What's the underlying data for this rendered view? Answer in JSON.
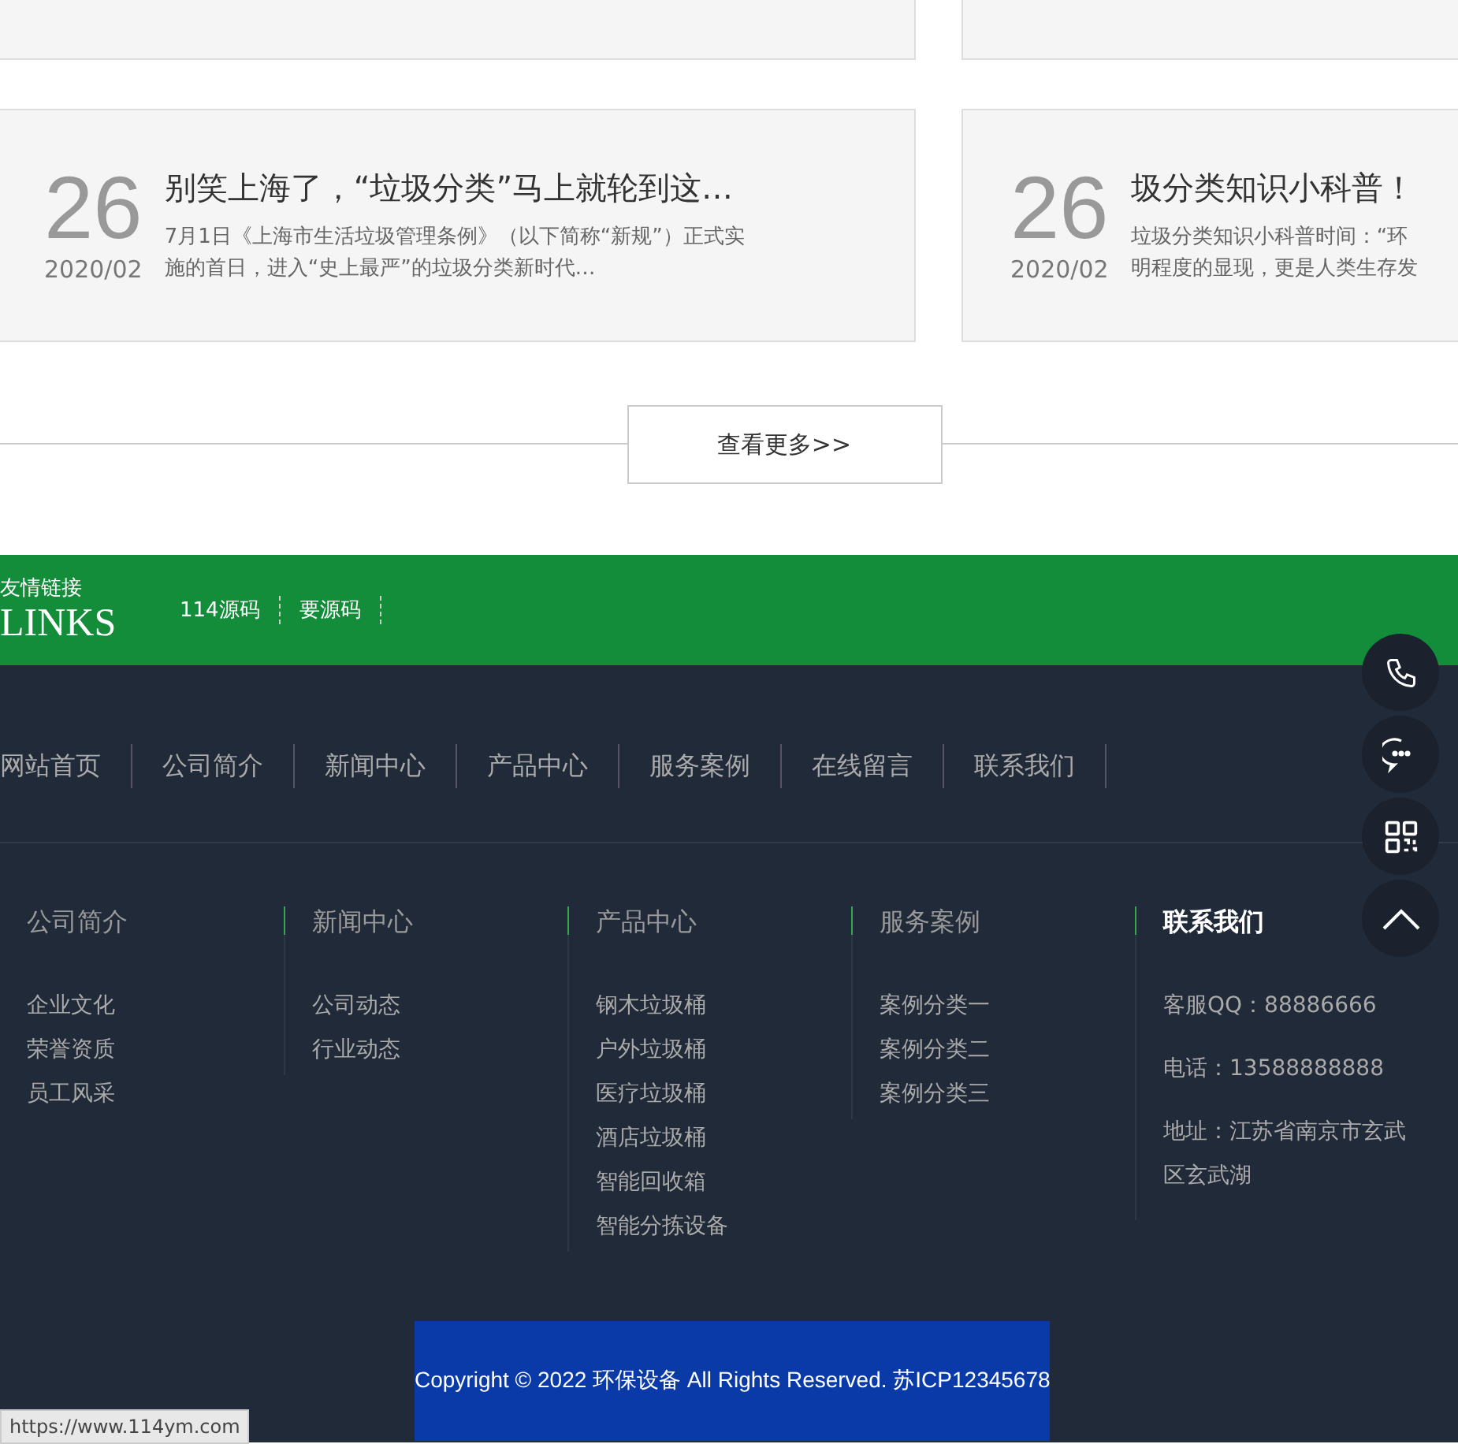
{
  "news_cards": [
    {
      "day": "26",
      "month": "2020/02",
      "title": "别笑上海了，“垃圾分类”马上就轮到这…",
      "summary": [
        "7月1日《上海市生活垃圾管理条例》（以下简称“新规”）正式实",
        "施的首日，进入“史上最严”的垃圾分类新时代…"
      ]
    },
    {
      "day": "26",
      "month": "2020/02",
      "title": "圾分类知识小科普！",
      "summary": [
        "垃圾分类知识小科普时间：“环",
        "明程度的显现，更是人类生存发"
      ]
    }
  ],
  "more_button": "查看更多>>",
  "friend_links": {
    "title": "友情链接",
    "subtitle": "LINKS",
    "links": [
      "114源码",
      "要源码"
    ]
  },
  "footer_nav": [
    "网站首页",
    "公司简介",
    "新闻中心",
    "产品中心",
    "服务案例",
    "在线留言",
    "联系我们"
  ],
  "footer_columns": [
    {
      "kind": "links",
      "title": "公司简介",
      "items": [
        "企业文化",
        "荣誉资质",
        "员工风采"
      ]
    },
    {
      "kind": "links",
      "title": "新闻中心",
      "items": [
        "公司动态",
        "行业动态"
      ]
    },
    {
      "kind": "links",
      "title": "产品中心",
      "items": [
        "钢木垃圾桶",
        "户外垃圾桶",
        "医疗垃圾桶",
        "酒店垃圾桶",
        "智能回收箱",
        "智能分拣设备"
      ]
    },
    {
      "kind": "links",
      "title": "服务案例",
      "items": [
        "案例分类一",
        "案例分类二",
        "案例分类三"
      ]
    },
    {
      "kind": "contact",
      "title": "联系我们",
      "items": [
        "客服QQ：88886666",
        "电话：13588888888",
        "地址：江苏省南京市玄武区玄武湖"
      ]
    }
  ],
  "copyright": "Copyright © 2022 环保设备 All Rights Reserved. 苏ICP12345678",
  "status_url": "https://www.114ym.com"
}
